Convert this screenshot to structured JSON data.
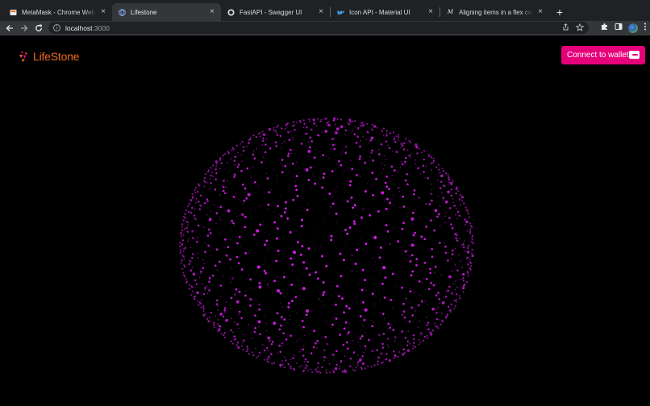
{
  "browser": {
    "tabs": [
      {
        "title": "MetaMask - Chrome Web Store",
        "icon": "metamask-icon",
        "active": false
      },
      {
        "title": "Lifestone",
        "icon": "globe-icon",
        "active": true
      },
      {
        "title": "FastAPI - Swagger UI",
        "icon": "fastapi-icon",
        "active": false
      },
      {
        "title": "Icon API - Material UI",
        "icon": "mui-icon",
        "active": false
      },
      {
        "title": "Aligning items in a flex container",
        "icon": "mdn-icon",
        "active": false
      }
    ],
    "new_tab_label": "+",
    "address": {
      "host": "localhost",
      "port": ":3000"
    }
  },
  "header": {
    "brand": "LifeStone",
    "brand_color": "#f26a21",
    "connect_button": "Connect to wallet",
    "connect_color": "#e6007a"
  },
  "visual": {
    "particle_color": "#d21ee6"
  }
}
